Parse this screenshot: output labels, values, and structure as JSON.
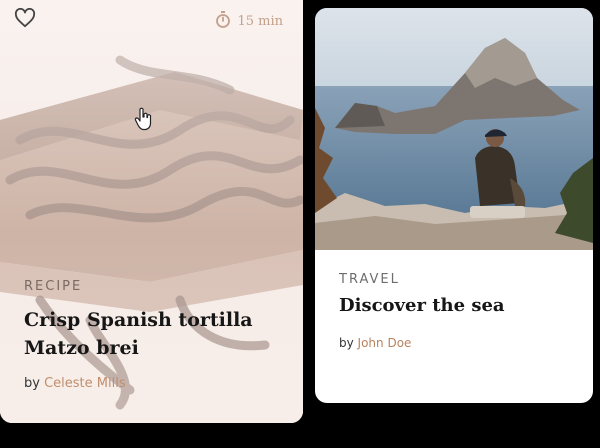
{
  "cards": [
    {
      "category": "RECIPE",
      "title": "Crisp Spanish tortilla Matzo brei",
      "by_label": "by",
      "author": "Celeste Mills",
      "time": "15 min",
      "icons": [
        "heart-icon",
        "stopwatch-icon"
      ],
      "state": "hovered"
    },
    {
      "category": "TRAVEL",
      "title": "Discover the sea",
      "by_label": "by",
      "author": "John Doe"
    }
  ],
  "colors": {
    "accent_author": "#c08e6b",
    "time_text": "#c3a08a",
    "page_bg": "#000000",
    "card_bg": "#ffffff"
  }
}
